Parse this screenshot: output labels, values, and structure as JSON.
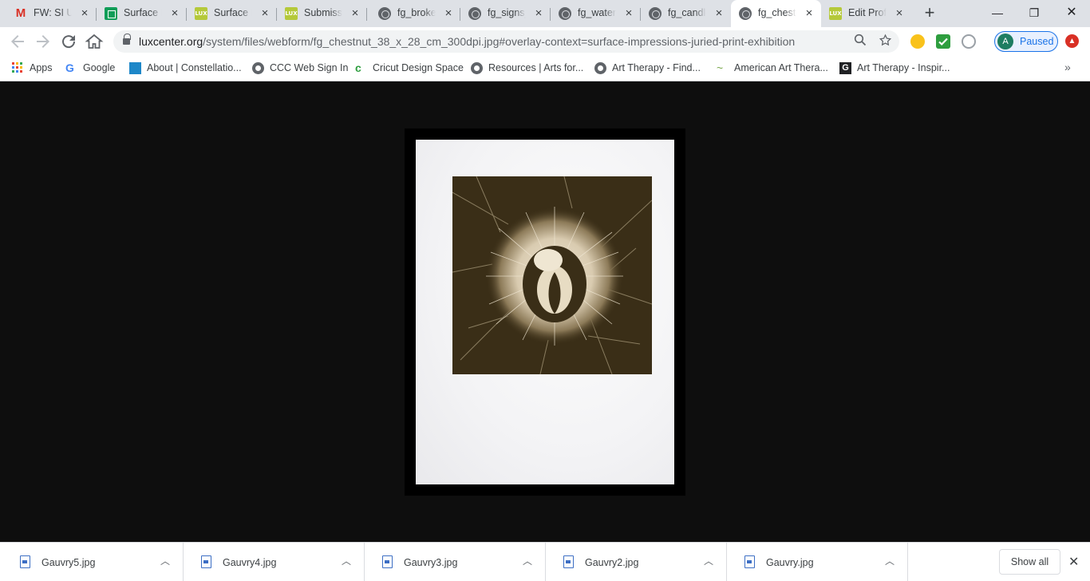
{
  "tabs": [
    {
      "title": "FW: SI Ur",
      "icon": "gmail-icon"
    },
    {
      "title": "Surface Im",
      "icon": "sheets-icon"
    },
    {
      "title": "Surface Im",
      "icon": "lux-icon"
    },
    {
      "title": "Submissio",
      "icon": "lux-icon"
    },
    {
      "title": "fg_broke",
      "icon": "globe-icon"
    },
    {
      "title": "fg_signs_",
      "icon": "globe-icon"
    },
    {
      "title": "fg_water",
      "icon": "globe-icon"
    },
    {
      "title": "fg_candle",
      "icon": "globe-icon"
    },
    {
      "title": "fg_chestn",
      "icon": "globe-icon",
      "active": true
    },
    {
      "title": "Edit Profil",
      "icon": "lux-icon"
    }
  ],
  "lux_favicon_text": "LUX",
  "window_controls": {
    "minimize": "—",
    "maximize": "❐",
    "close": "✕"
  },
  "address_bar": {
    "host": "luxcenter.org",
    "path": "/system/files/webform/fg_chestnut_38_x_28_cm_300dpi.jpg#overlay-context=surface-impressions-juried-print-exhibition"
  },
  "profile": {
    "initial": "A",
    "status": "Paused"
  },
  "bookmarks": [
    {
      "label": "Apps",
      "icon": "apps-grid-icon"
    },
    {
      "label": "Google",
      "icon": "google-icon"
    },
    {
      "label": "About | Constellatio...",
      "icon": "constellation-icon"
    },
    {
      "label": "CCC Web Sign In",
      "icon": "globe-icon"
    },
    {
      "label": "Cricut Design Space",
      "icon": "cricut-icon"
    },
    {
      "label": "Resources | Arts for...",
      "icon": "globe-icon"
    },
    {
      "label": "Art Therapy - Find...",
      "icon": "globe-icon"
    },
    {
      "label": "American Art Thera...",
      "icon": "wave-icon"
    },
    {
      "label": "Art Therapy - Inspir...",
      "icon": "g-square-icon"
    }
  ],
  "image_viewer": {
    "subject": "chestnut burr print"
  },
  "downloads": [
    {
      "filename": "Gauvry5.jpg"
    },
    {
      "filename": "Gauvry4.jpg"
    },
    {
      "filename": "Gauvry3.jpg"
    },
    {
      "filename": "Gauvry2.jpg"
    },
    {
      "filename": "Gauvry.jpg"
    }
  ],
  "downloads_show_all": "Show all",
  "colors": {
    "accent": "#1a73e8",
    "tabstrip": "#dee1e6",
    "viewer_bg": "#0e0e0e",
    "print_sepia": "#3d3119"
  }
}
